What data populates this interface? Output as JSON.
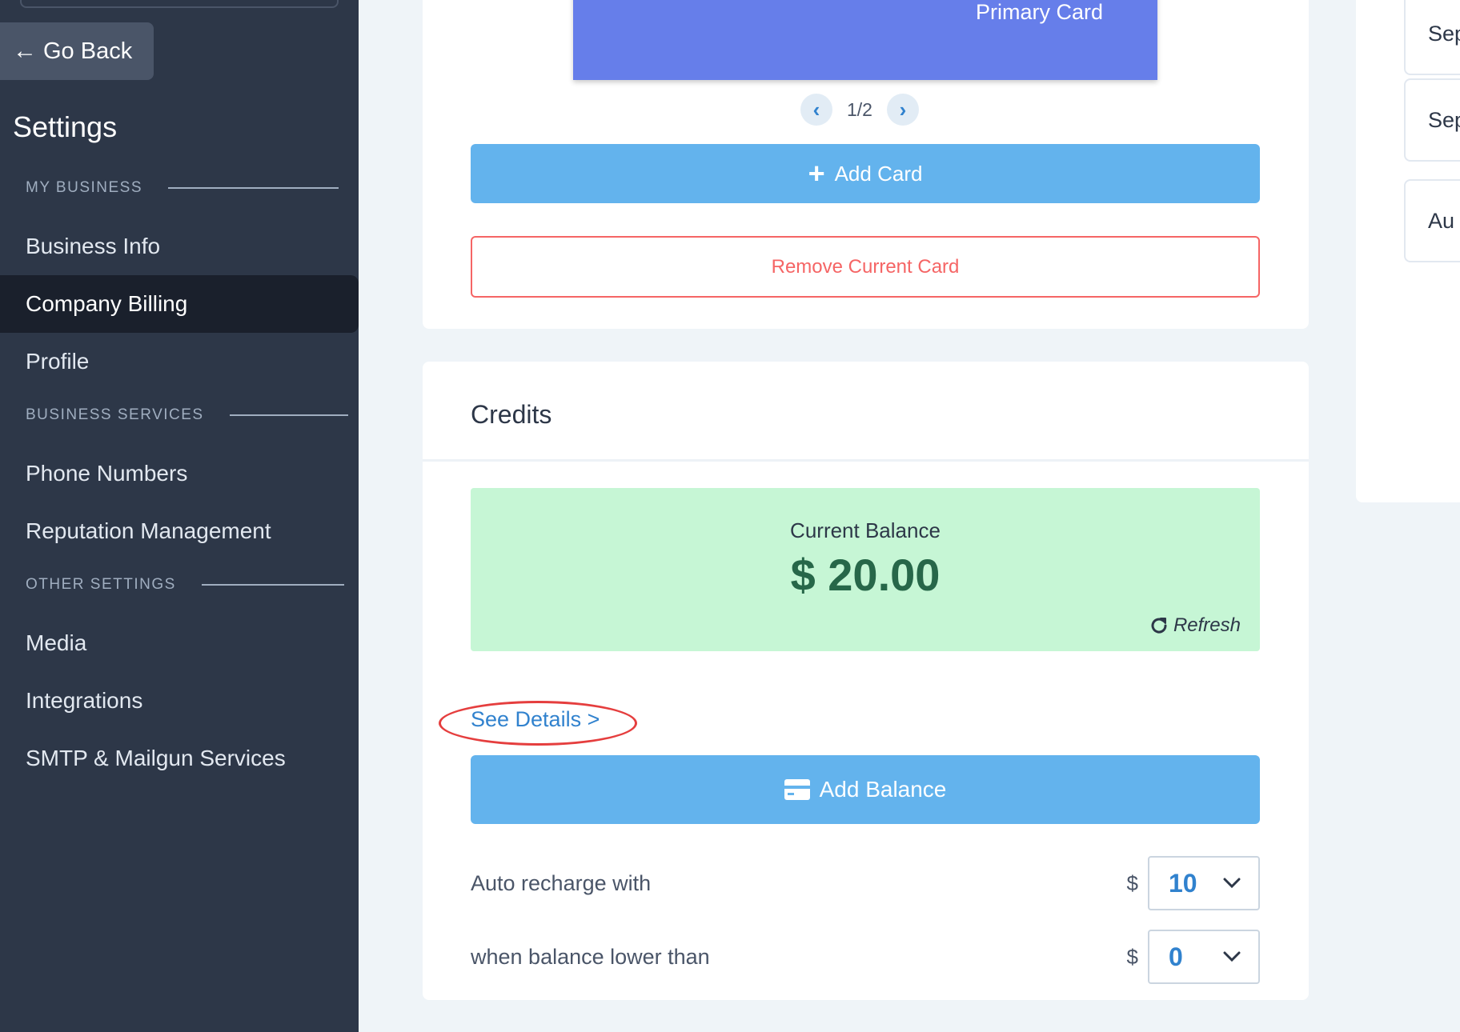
{
  "sidebar": {
    "go_back_label": "Go Back",
    "title": "Settings",
    "sections": {
      "my_business": "MY BUSINESS",
      "business_services": "BUSINESS SERVICES",
      "other_settings": "OTHER SETTINGS"
    },
    "items": {
      "business_info": "Business Info",
      "company_billing": "Company Billing",
      "profile": "Profile",
      "phone_numbers": "Phone Numbers",
      "reputation_management": "Reputation Management",
      "media": "Media",
      "integrations": "Integrations",
      "smtp": "SMTP & Mailgun Services"
    },
    "active_item": "Company Billing"
  },
  "cards_section": {
    "primary_card_label": "Primary Card",
    "pager": "1/2",
    "add_card_label": "Add Card",
    "remove_card_label": "Remove Current Card"
  },
  "credits": {
    "title": "Credits",
    "balance_label": "Current Balance",
    "balance_amount": "$ 20.00",
    "refresh_label": "Refresh",
    "see_details_label": "See Details >",
    "add_balance_label": "Add Balance",
    "auto_recharge_label": "Auto recharge with",
    "auto_recharge_currency": "$",
    "auto_recharge_value": "10",
    "threshold_label": "when balance lower than",
    "threshold_currency": "$",
    "threshold_value": "0"
  },
  "right_panel": {
    "items": [
      "Sep",
      "Sep",
      "Au"
    ]
  },
  "colors": {
    "sidebar_bg": "#2d3748",
    "active_nav_bg": "#1a202c",
    "primary_card": "#667eea",
    "button_blue": "#63b3ed",
    "danger": "#f56565",
    "balance_bg": "#c6f6d5",
    "balance_text": "#276749",
    "link": "#3182ce",
    "highlight": "#e53e3e"
  }
}
